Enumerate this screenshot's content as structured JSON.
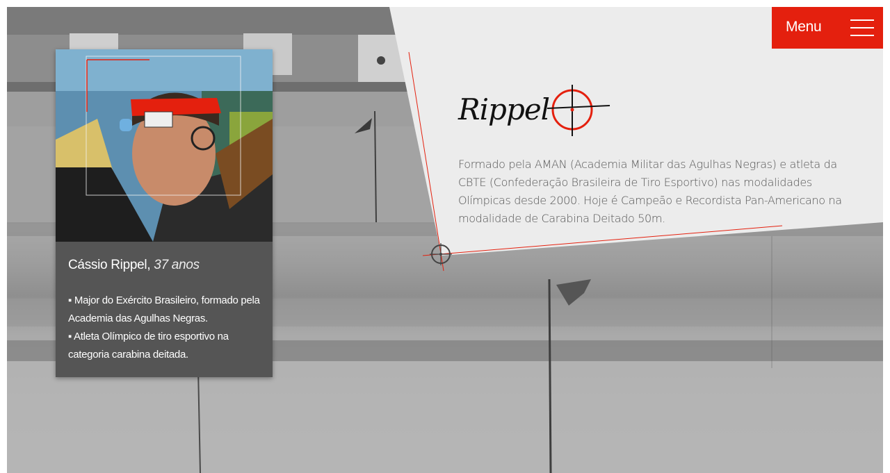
{
  "menu": {
    "label": "Menu",
    "icon": "hamburger-icon"
  },
  "logo": {
    "text": "Rippel",
    "icon": "crosshair-icon",
    "accent_color": "#e4200e"
  },
  "bio": {
    "text": "Formado pela AMAN (Academia Militar das Agulhas Negras) e atleta da CBTE (Confederação Brasileira de Tiro Esportivo) nas modalidades Olímpicas desde 2000. Hoje é Campeão e Recordista Pan-Americano na modalidade de Carabina Deitado 50m."
  },
  "profile": {
    "name": "Cássio Rippel,",
    "age": "37 anos",
    "facts": [
      "▪ Major do Exército Brasileiro, formado pela Academia das Agulhas Negras.",
      "▪ Atleta Olímpico de tiro esportivo na categoria carabina deitada."
    ]
  },
  "colors": {
    "accent": "#e4200e",
    "card": "#555555",
    "panel": "#ececec",
    "text": "#555555"
  }
}
